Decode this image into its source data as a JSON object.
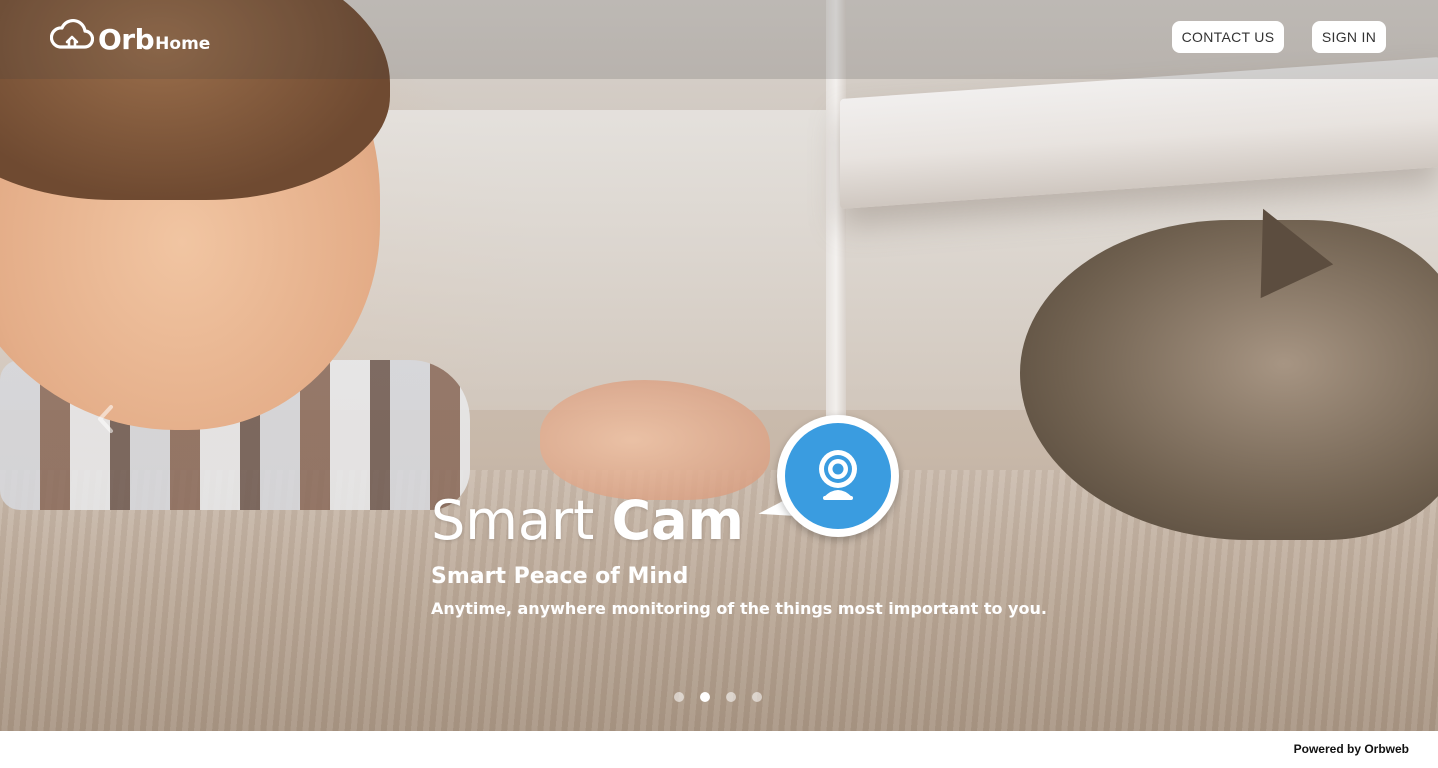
{
  "header": {
    "logo": {
      "brand": "Orb",
      "brand_sub": "Home",
      "icon": "cloud-home-icon"
    },
    "contact_label": "CONTACT US",
    "signin_label": "SIGN IN"
  },
  "hero": {
    "title_light": "Smart",
    "title_bold": "Cam",
    "subtitle": "Smart Peace of Mind",
    "tagline": "Anytime, anywhere monitoring of the things most important to you.",
    "badge_icon": "webcam-icon",
    "badge_color": "#3a9ce0",
    "prev_icon": "chevron-left-icon"
  },
  "carousel": {
    "slides": 4,
    "active_index": 1
  },
  "footer": {
    "powered_by": "Powered by Orbweb"
  }
}
